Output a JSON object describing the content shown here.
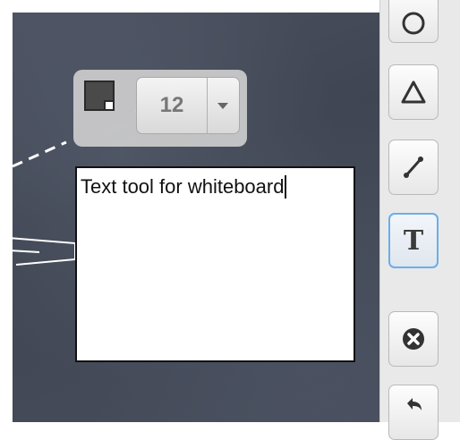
{
  "style_panel": {
    "selected_color": "#4a4a4a",
    "font_size": "12"
  },
  "text_box": {
    "text": "Text tool for whiteboard"
  },
  "toolbar": {
    "tools": [
      {
        "name": "circle-tool",
        "icon": "circle-icon"
      },
      {
        "name": "triangle-tool",
        "icon": "triangle-icon"
      },
      {
        "name": "line-tool",
        "icon": "line-icon"
      },
      {
        "name": "text-tool",
        "icon": "text-icon",
        "glyph": "T",
        "active": true
      },
      {
        "name": "clear-tool",
        "icon": "close-circle-icon"
      },
      {
        "name": "undo-tool",
        "icon": "undo-icon"
      }
    ]
  },
  "colors": {
    "board": "#444a57",
    "active_tool_border": "#6aaee8"
  }
}
